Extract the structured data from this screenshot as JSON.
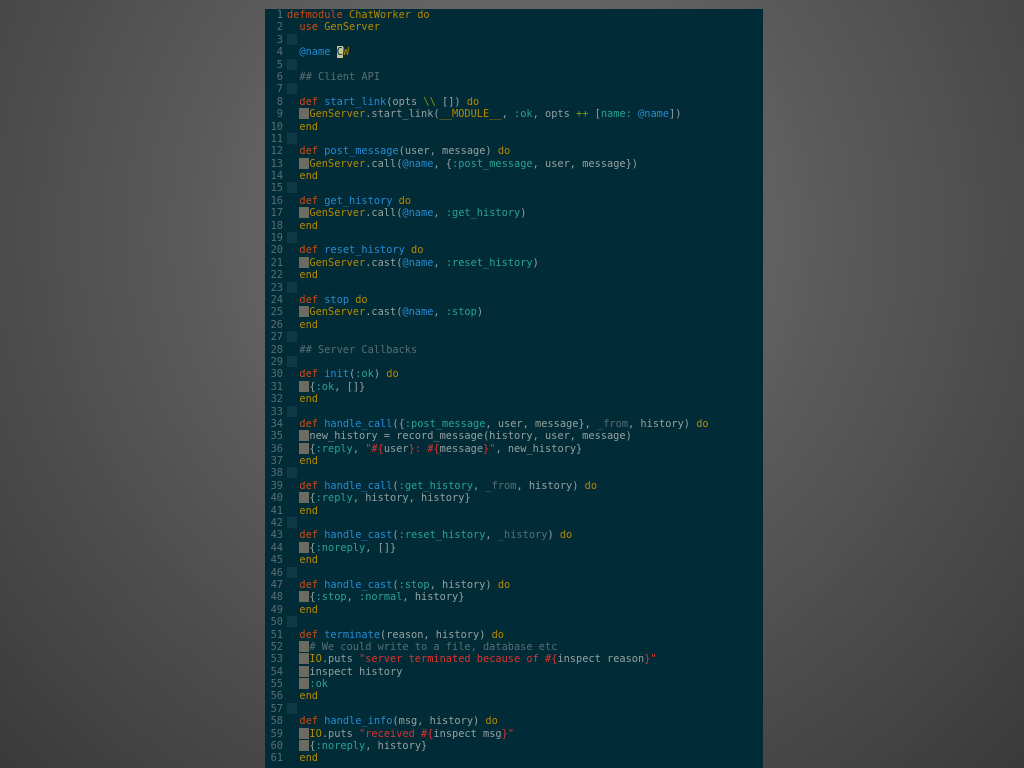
{
  "editor": {
    "lines": [
      [
        {
          "t": "defmodule",
          "c": "kw"
        },
        {
          "t": " ",
          "c": "tx"
        },
        {
          "t": "ChatWorker",
          "c": "mod"
        },
        {
          "t": " do",
          "c": "kw2"
        }
      ],
      [
        {
          "t": "  ",
          "c": "tx"
        },
        {
          "t": "use",
          "c": "kw"
        },
        {
          "t": " ",
          "c": "tx"
        },
        {
          "t": "GenServer",
          "c": "mod"
        }
      ],
      [
        {
          "t": "",
          "c": "ws"
        }
      ],
      [
        {
          "t": "  ",
          "c": "tx"
        },
        {
          "t": "@name",
          "c": "at"
        },
        {
          "t": " ",
          "c": "tx"
        },
        {
          "t": "C",
          "c": "cur"
        },
        {
          "t": "W",
          "c": "mod"
        }
      ],
      [
        {
          "t": "",
          "c": "ws"
        }
      ],
      [
        {
          "t": "  ",
          "c": "tx"
        },
        {
          "t": "## Client API",
          "c": "cm"
        }
      ],
      [
        {
          "t": "",
          "c": "ws"
        }
      ],
      [
        {
          "t": "  ",
          "c": "tx"
        },
        {
          "t": "def",
          "c": "kw"
        },
        {
          "t": " ",
          "c": "tx"
        },
        {
          "t": "start_link",
          "c": "fn"
        },
        {
          "t": "(opts ",
          "c": "tx"
        },
        {
          "t": "\\\\",
          "c": "op"
        },
        {
          "t": " [])",
          "c": "tx"
        },
        {
          "t": " do",
          "c": "kw2"
        }
      ],
      [
        {
          "t": "  ",
          "c": "tx"
        },
        {
          "t": "",
          "c": "ind"
        },
        {
          "t": "GenServer",
          "c": "mod"
        },
        {
          "t": ".start_link(",
          "c": "tx"
        },
        {
          "t": "__MODULE__",
          "c": "mod"
        },
        {
          "t": ", ",
          "c": "tx"
        },
        {
          "t": ":ok",
          "c": "sym"
        },
        {
          "t": ", opts ",
          "c": "tx"
        },
        {
          "t": "++",
          "c": "op"
        },
        {
          "t": " [",
          "c": "tx"
        },
        {
          "t": "name:",
          "c": "sym"
        },
        {
          "t": " ",
          "c": "tx"
        },
        {
          "t": "@name",
          "c": "at"
        },
        {
          "t": "])",
          "c": "tx"
        }
      ],
      [
        {
          "t": "  ",
          "c": "tx"
        },
        {
          "t": "end",
          "c": "kw2"
        }
      ],
      [
        {
          "t": "",
          "c": "ws"
        }
      ],
      [
        {
          "t": "  ",
          "c": "tx"
        },
        {
          "t": "def",
          "c": "kw"
        },
        {
          "t": " ",
          "c": "tx"
        },
        {
          "t": "post_message",
          "c": "fn"
        },
        {
          "t": "(user, message)",
          "c": "tx"
        },
        {
          "t": " do",
          "c": "kw2"
        }
      ],
      [
        {
          "t": "  ",
          "c": "tx"
        },
        {
          "t": "",
          "c": "ind"
        },
        {
          "t": "GenServer",
          "c": "mod"
        },
        {
          "t": ".call(",
          "c": "tx"
        },
        {
          "t": "@name",
          "c": "at"
        },
        {
          "t": ", {",
          "c": "tx"
        },
        {
          "t": ":post_message",
          "c": "sym"
        },
        {
          "t": ", user, message})",
          "c": "tx"
        }
      ],
      [
        {
          "t": "  ",
          "c": "tx"
        },
        {
          "t": "end",
          "c": "kw2"
        }
      ],
      [
        {
          "t": "",
          "c": "ws"
        }
      ],
      [
        {
          "t": "  ",
          "c": "tx"
        },
        {
          "t": "def",
          "c": "kw"
        },
        {
          "t": " ",
          "c": "tx"
        },
        {
          "t": "get_history",
          "c": "fn"
        },
        {
          "t": " do",
          "c": "kw2"
        }
      ],
      [
        {
          "t": "  ",
          "c": "tx"
        },
        {
          "t": "",
          "c": "ind"
        },
        {
          "t": "GenServer",
          "c": "mod"
        },
        {
          "t": ".call(",
          "c": "tx"
        },
        {
          "t": "@name",
          "c": "at"
        },
        {
          "t": ", ",
          "c": "tx"
        },
        {
          "t": ":get_history",
          "c": "sym"
        },
        {
          "t": ")",
          "c": "tx"
        }
      ],
      [
        {
          "t": "  ",
          "c": "tx"
        },
        {
          "t": "end",
          "c": "kw2"
        }
      ],
      [
        {
          "t": "",
          "c": "ws"
        }
      ],
      [
        {
          "t": "  ",
          "c": "tx"
        },
        {
          "t": "def",
          "c": "kw"
        },
        {
          "t": " ",
          "c": "tx"
        },
        {
          "t": "reset_history",
          "c": "fn"
        },
        {
          "t": " do",
          "c": "kw2"
        }
      ],
      [
        {
          "t": "  ",
          "c": "tx"
        },
        {
          "t": "",
          "c": "ind"
        },
        {
          "t": "GenServer",
          "c": "mod"
        },
        {
          "t": ".cast(",
          "c": "tx"
        },
        {
          "t": "@name",
          "c": "at"
        },
        {
          "t": ", ",
          "c": "tx"
        },
        {
          "t": ":reset_history",
          "c": "sym"
        },
        {
          "t": ")",
          "c": "tx"
        }
      ],
      [
        {
          "t": "  ",
          "c": "tx"
        },
        {
          "t": "end",
          "c": "kw2"
        }
      ],
      [
        {
          "t": "",
          "c": "ws"
        }
      ],
      [
        {
          "t": "  ",
          "c": "tx"
        },
        {
          "t": "def",
          "c": "kw"
        },
        {
          "t": " ",
          "c": "tx"
        },
        {
          "t": "stop",
          "c": "fn"
        },
        {
          "t": " do",
          "c": "kw2"
        }
      ],
      [
        {
          "t": "  ",
          "c": "tx"
        },
        {
          "t": "",
          "c": "ind"
        },
        {
          "t": "GenServer",
          "c": "mod"
        },
        {
          "t": ".cast(",
          "c": "tx"
        },
        {
          "t": "@name",
          "c": "at"
        },
        {
          "t": ", ",
          "c": "tx"
        },
        {
          "t": ":stop",
          "c": "sym"
        },
        {
          "t": ")",
          "c": "tx"
        }
      ],
      [
        {
          "t": "  ",
          "c": "tx"
        },
        {
          "t": "end",
          "c": "kw2"
        }
      ],
      [
        {
          "t": "",
          "c": "ws"
        }
      ],
      [
        {
          "t": "  ",
          "c": "tx"
        },
        {
          "t": "## Server Callbacks",
          "c": "cm"
        }
      ],
      [
        {
          "t": "",
          "c": "ws"
        }
      ],
      [
        {
          "t": "  ",
          "c": "tx"
        },
        {
          "t": "def",
          "c": "kw"
        },
        {
          "t": " ",
          "c": "tx"
        },
        {
          "t": "init",
          "c": "fn"
        },
        {
          "t": "(",
          "c": "tx"
        },
        {
          "t": ":ok",
          "c": "sym"
        },
        {
          "t": ")",
          "c": "tx"
        },
        {
          "t": " do",
          "c": "kw2"
        }
      ],
      [
        {
          "t": "  ",
          "c": "tx"
        },
        {
          "t": "",
          "c": "ind"
        },
        {
          "t": "{",
          "c": "tx"
        },
        {
          "t": ":ok",
          "c": "sym"
        },
        {
          "t": ", []}",
          "c": "tx"
        }
      ],
      [
        {
          "t": "  ",
          "c": "tx"
        },
        {
          "t": "end",
          "c": "kw2"
        }
      ],
      [
        {
          "t": "",
          "c": "ws"
        }
      ],
      [
        {
          "t": "  ",
          "c": "tx"
        },
        {
          "t": "def",
          "c": "kw"
        },
        {
          "t": " ",
          "c": "tx"
        },
        {
          "t": "handle_call",
          "c": "fn"
        },
        {
          "t": "({",
          "c": "tx"
        },
        {
          "t": ":post_message",
          "c": "sym"
        },
        {
          "t": ", user, message}, ",
          "c": "tx"
        },
        {
          "t": "_from",
          "c": "cm"
        },
        {
          "t": ", history)",
          "c": "tx"
        },
        {
          "t": " do",
          "c": "kw2"
        }
      ],
      [
        {
          "t": "  ",
          "c": "tx"
        },
        {
          "t": "",
          "c": "ind"
        },
        {
          "t": "new_history = record_message(history, user, message)",
          "c": "tx"
        }
      ],
      [
        {
          "t": "  ",
          "c": "tx"
        },
        {
          "t": "",
          "c": "ind"
        },
        {
          "t": "{",
          "c": "tx"
        },
        {
          "t": ":reply",
          "c": "sym"
        },
        {
          "t": ", ",
          "c": "tx"
        },
        {
          "t": "\"#{",
          "c": "str"
        },
        {
          "t": "user",
          "c": "tx"
        },
        {
          "t": "}: #{",
          "c": "str"
        },
        {
          "t": "message",
          "c": "tx"
        },
        {
          "t": "}\"",
          "c": "str"
        },
        {
          "t": ", new_history}",
          "c": "tx"
        }
      ],
      [
        {
          "t": "  ",
          "c": "tx"
        },
        {
          "t": "end",
          "c": "kw2"
        }
      ],
      [
        {
          "t": "",
          "c": "ws"
        }
      ],
      [
        {
          "t": "  ",
          "c": "tx"
        },
        {
          "t": "def",
          "c": "kw"
        },
        {
          "t": " ",
          "c": "tx"
        },
        {
          "t": "handle_call",
          "c": "fn"
        },
        {
          "t": "(",
          "c": "tx"
        },
        {
          "t": ":get_history",
          "c": "sym"
        },
        {
          "t": ", ",
          "c": "tx"
        },
        {
          "t": "_from",
          "c": "cm"
        },
        {
          "t": ", history)",
          "c": "tx"
        },
        {
          "t": " do",
          "c": "kw2"
        }
      ],
      [
        {
          "t": "  ",
          "c": "tx"
        },
        {
          "t": "",
          "c": "ind"
        },
        {
          "t": "{",
          "c": "tx"
        },
        {
          "t": ":reply",
          "c": "sym"
        },
        {
          "t": ", history, history}",
          "c": "tx"
        }
      ],
      [
        {
          "t": "  ",
          "c": "tx"
        },
        {
          "t": "end",
          "c": "kw2"
        }
      ],
      [
        {
          "t": "",
          "c": "ws"
        }
      ],
      [
        {
          "t": "  ",
          "c": "tx"
        },
        {
          "t": "def",
          "c": "kw"
        },
        {
          "t": " ",
          "c": "tx"
        },
        {
          "t": "handle_cast",
          "c": "fn"
        },
        {
          "t": "(",
          "c": "tx"
        },
        {
          "t": ":reset_history",
          "c": "sym"
        },
        {
          "t": ", ",
          "c": "tx"
        },
        {
          "t": "_history",
          "c": "cm"
        },
        {
          "t": ")",
          "c": "tx"
        },
        {
          "t": " do",
          "c": "kw2"
        }
      ],
      [
        {
          "t": "  ",
          "c": "tx"
        },
        {
          "t": "",
          "c": "ind"
        },
        {
          "t": "{",
          "c": "tx"
        },
        {
          "t": ":noreply",
          "c": "sym"
        },
        {
          "t": ", []}",
          "c": "tx"
        }
      ],
      [
        {
          "t": "  ",
          "c": "tx"
        },
        {
          "t": "end",
          "c": "kw2"
        }
      ],
      [
        {
          "t": "",
          "c": "ws"
        }
      ],
      [
        {
          "t": "  ",
          "c": "tx"
        },
        {
          "t": "def",
          "c": "kw"
        },
        {
          "t": " ",
          "c": "tx"
        },
        {
          "t": "handle_cast",
          "c": "fn"
        },
        {
          "t": "(",
          "c": "tx"
        },
        {
          "t": ":stop",
          "c": "sym"
        },
        {
          "t": ", history)",
          "c": "tx"
        },
        {
          "t": " do",
          "c": "kw2"
        }
      ],
      [
        {
          "t": "  ",
          "c": "tx"
        },
        {
          "t": "",
          "c": "ind"
        },
        {
          "t": "{",
          "c": "tx"
        },
        {
          "t": ":stop",
          "c": "sym"
        },
        {
          "t": ", ",
          "c": "tx"
        },
        {
          "t": ":normal",
          "c": "sym"
        },
        {
          "t": ", history}",
          "c": "tx"
        }
      ],
      [
        {
          "t": "  ",
          "c": "tx"
        },
        {
          "t": "end",
          "c": "kw2"
        }
      ],
      [
        {
          "t": "",
          "c": "ws"
        }
      ],
      [
        {
          "t": "  ",
          "c": "tx"
        },
        {
          "t": "def",
          "c": "kw"
        },
        {
          "t": " ",
          "c": "tx"
        },
        {
          "t": "terminate",
          "c": "fn"
        },
        {
          "t": "(reason, history)",
          "c": "tx"
        },
        {
          "t": " do",
          "c": "kw2"
        }
      ],
      [
        {
          "t": "  ",
          "c": "tx"
        },
        {
          "t": "",
          "c": "ind"
        },
        {
          "t": "# We could write to a file, database etc",
          "c": "cm"
        }
      ],
      [
        {
          "t": "  ",
          "c": "tx"
        },
        {
          "t": "",
          "c": "ind"
        },
        {
          "t": "IO",
          "c": "mod"
        },
        {
          "t": ".puts ",
          "c": "tx"
        },
        {
          "t": "\"server terminated because of #{",
          "c": "str"
        },
        {
          "t": "inspect reason",
          "c": "tx"
        },
        {
          "t": "}\"",
          "c": "str"
        }
      ],
      [
        {
          "t": "  ",
          "c": "tx"
        },
        {
          "t": "",
          "c": "ind"
        },
        {
          "t": "inspect history",
          "c": "tx"
        }
      ],
      [
        {
          "t": "  ",
          "c": "tx"
        },
        {
          "t": "",
          "c": "ind"
        },
        {
          "t": ":ok",
          "c": "sym"
        }
      ],
      [
        {
          "t": "  ",
          "c": "tx"
        },
        {
          "t": "end",
          "c": "kw2"
        }
      ],
      [
        {
          "t": "",
          "c": "ws"
        }
      ],
      [
        {
          "t": "  ",
          "c": "tx"
        },
        {
          "t": "def",
          "c": "kw"
        },
        {
          "t": " ",
          "c": "tx"
        },
        {
          "t": "handle_info",
          "c": "fn"
        },
        {
          "t": "(msg, history)",
          "c": "tx"
        },
        {
          "t": " do",
          "c": "kw2"
        }
      ],
      [
        {
          "t": "  ",
          "c": "tx"
        },
        {
          "t": "",
          "c": "ind"
        },
        {
          "t": "IO",
          "c": "mod"
        },
        {
          "t": ".puts ",
          "c": "tx"
        },
        {
          "t": "\"received #{",
          "c": "str"
        },
        {
          "t": "inspect msg",
          "c": "tx"
        },
        {
          "t": "}\"",
          "c": "str"
        }
      ],
      [
        {
          "t": "  ",
          "c": "tx"
        },
        {
          "t": "",
          "c": "ind"
        },
        {
          "t": "{",
          "c": "tx"
        },
        {
          "t": ":noreply",
          "c": "sym"
        },
        {
          "t": ", history}",
          "c": "tx"
        }
      ],
      [
        {
          "t": "  ",
          "c": "tx"
        },
        {
          "t": "end",
          "c": "kw2"
        }
      ]
    ]
  }
}
